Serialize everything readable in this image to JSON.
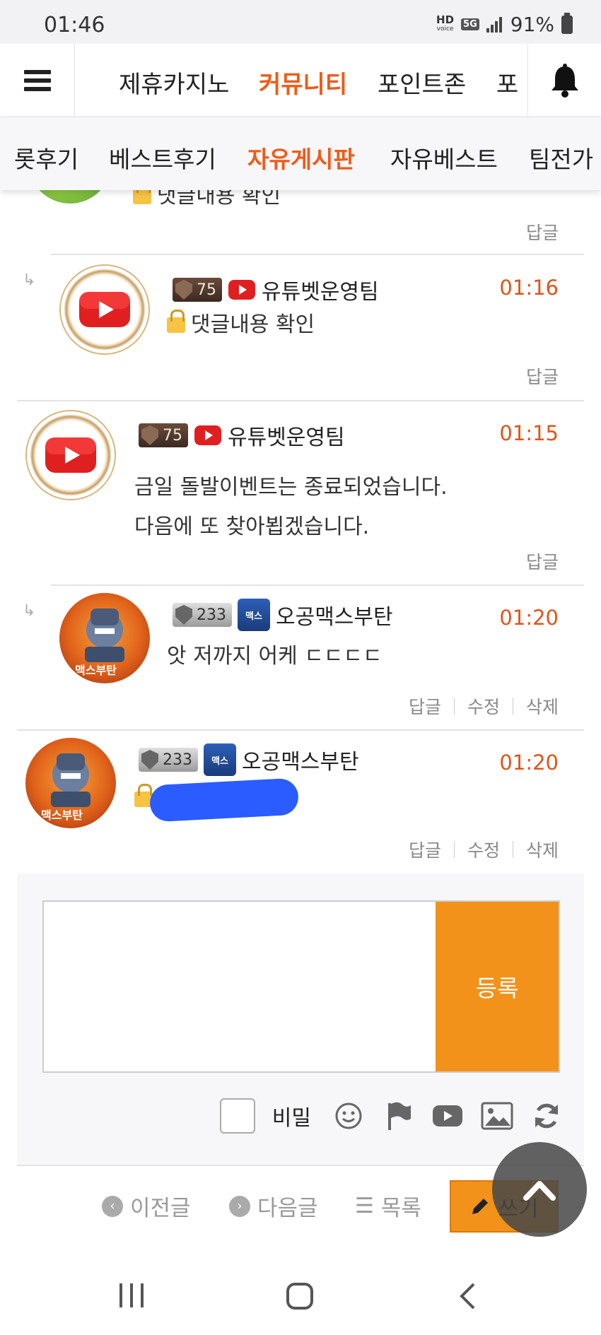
{
  "status": {
    "time": "01:46",
    "hd_label": "HD",
    "voice_label": "voice",
    "network": "5G",
    "battery": "91%"
  },
  "nav_primary": {
    "items": [
      "제휴카지노",
      "커뮤니티",
      "포인트존",
      "포"
    ],
    "active_index": 1
  },
  "nav_secondary": {
    "items": [
      "롯후기",
      "베스트후기",
      "자유게시판",
      "자유베스트",
      "팀전가"
    ],
    "active_index": 2
  },
  "accent_color": "#ef5b17",
  "comments": [
    {
      "body": "댓글내용 확인",
      "actions": [
        "답글"
      ]
    },
    {
      "level": "75",
      "nickname": "유튜벳운영팀",
      "time": "01:16",
      "body": "댓글내용 확인",
      "actions": [
        "답글"
      ]
    },
    {
      "level": "75",
      "nickname": "유튜벳운영팀",
      "time": "01:15",
      "body_line1": "금일 돌발이벤트는 종료되었습니다.",
      "body_line2": "다음에 또 찾아뵙겠습니다.",
      "actions": [
        "답글"
      ]
    },
    {
      "level": "233",
      "nickname": "오공맥스부탄",
      "time": "01:20",
      "body": "앗 저까지 어케 ㄷㄷㄷㄷ",
      "actions": [
        "답글",
        "수정",
        "삭제"
      ],
      "avatar_text": "맥스부탄",
      "badge_text": "맥스"
    },
    {
      "level": "233",
      "nickname": "오공맥스부탄",
      "time": "01:20",
      "actions": [
        "답글",
        "수정",
        "삭제"
      ],
      "avatar_text": "맥스부탄",
      "badge_text": "맥스"
    }
  ],
  "form": {
    "submit_label": "등록",
    "secret_label": "비밀"
  },
  "bottom_nav": {
    "prev": "이전글",
    "next": "다음글",
    "list": "목록",
    "write": "쓰기"
  },
  "submit_color": "#f2921b"
}
